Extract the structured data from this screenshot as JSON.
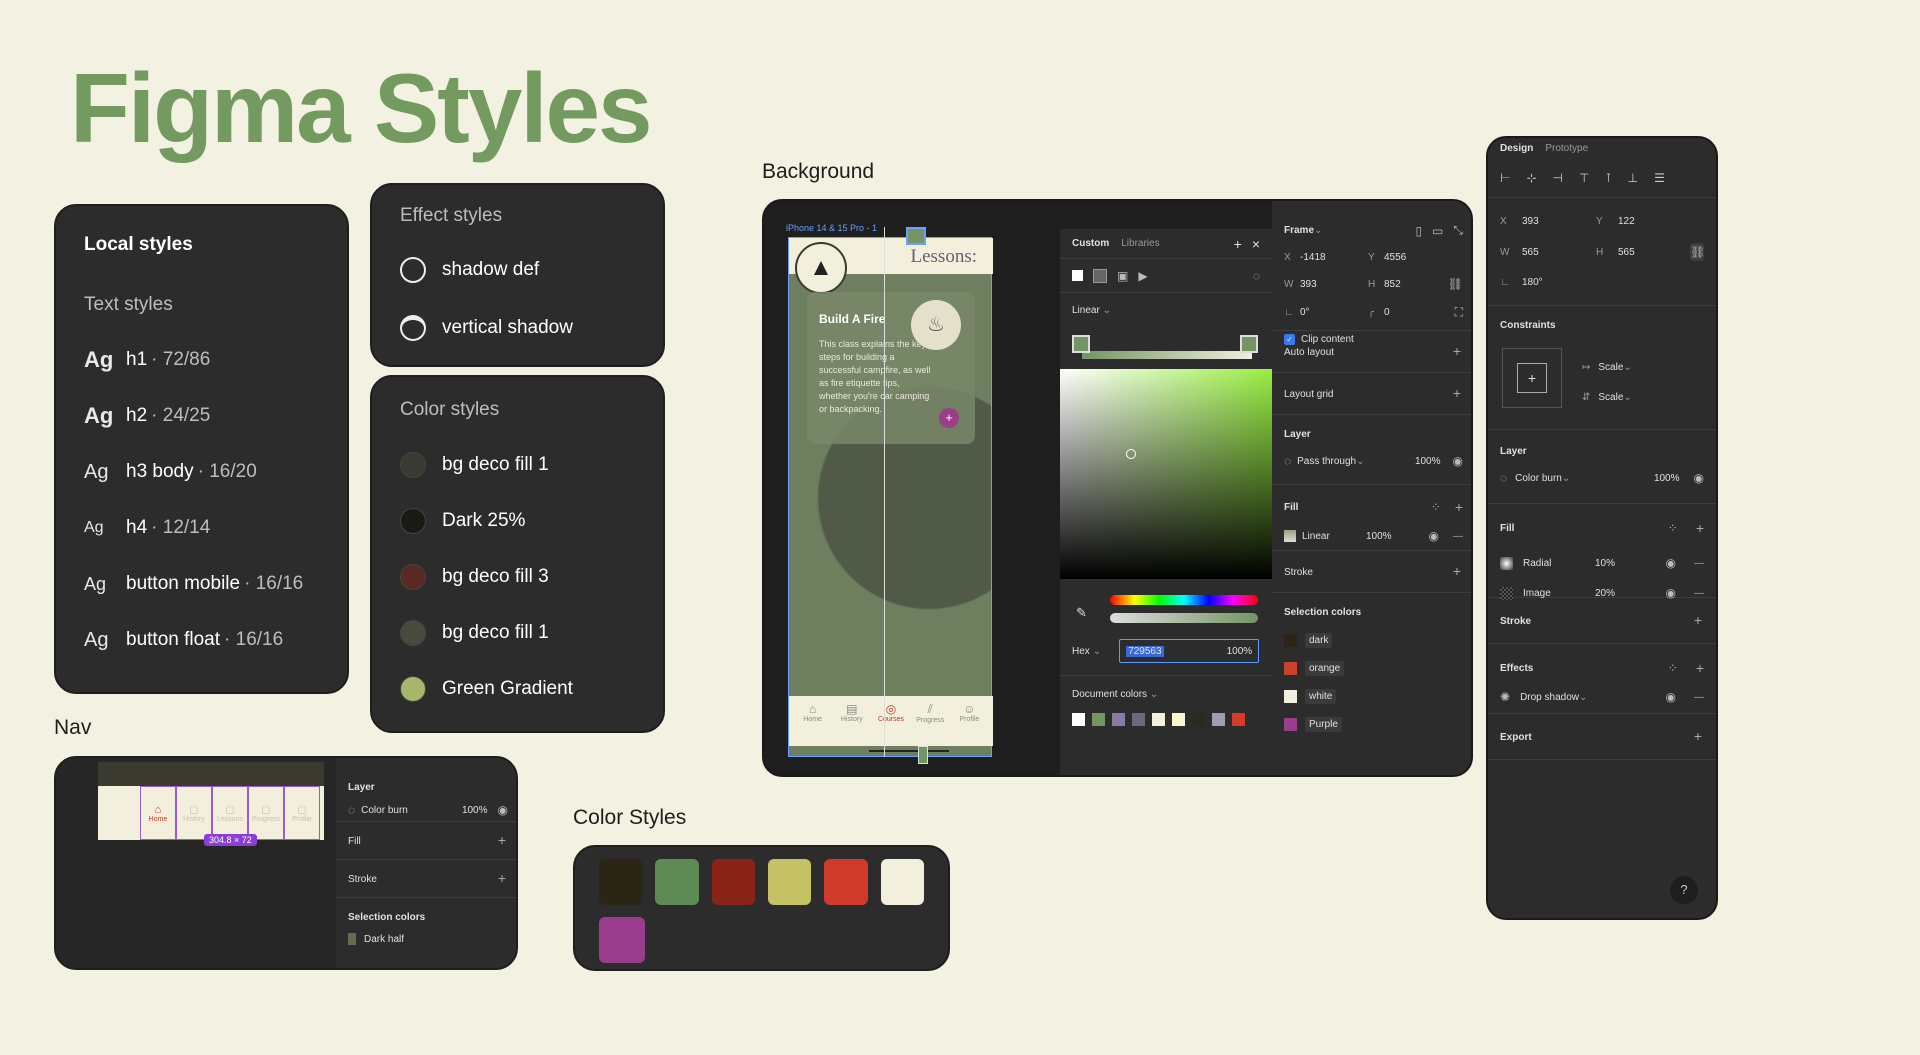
{
  "title": "Figma Styles",
  "captions": {
    "nav": "Nav",
    "background": "Background",
    "color_styles": "Color Styles"
  },
  "local_styles": {
    "heading": "Local styles",
    "text_styles_label": "Text styles",
    "items": [
      {
        "ag": "Ag",
        "name": "h1",
        "meta": "· 72/86"
      },
      {
        "ag": "Ag",
        "name": "h2",
        "meta": "· 24/25"
      },
      {
        "ag": "Ag",
        "name": "h3 body",
        "meta": "· 16/20"
      },
      {
        "ag": "Ag",
        "name": "h4",
        "meta": "· 12/14"
      },
      {
        "ag": "Ag",
        "name": "button mobile",
        "meta": "· 16/16"
      },
      {
        "ag": "Ag",
        "name": "button float",
        "meta": "· 16/16"
      }
    ]
  },
  "effect_styles": {
    "heading": "Effect styles",
    "items": [
      "shadow def",
      "vertical shadow"
    ]
  },
  "color_styles": {
    "heading": "Color styles",
    "items": [
      {
        "name": "bg deco fill 1",
        "color": "#3a3a32"
      },
      {
        "name": "Dark 25%",
        "color": "#1a1a14"
      },
      {
        "name": "bg deco fill 3",
        "color": "#5a2a22"
      },
      {
        "name": "bg deco fill 1",
        "color": "#4a4a3c"
      },
      {
        "name": "Green Gradient",
        "color": "#a7b86a"
      }
    ]
  },
  "nav_panel": {
    "tabs": [
      "Home",
      "History",
      "Lessons",
      "Progress",
      "Profile"
    ],
    "size_badge": "304.8 × 72",
    "layer_label": "Layer",
    "blend": "Color burn",
    "opacity": "100%",
    "fill": "Fill",
    "stroke": "Stroke",
    "selection_colors": "Selection colors",
    "sel_item": "Dark half"
  },
  "phone": {
    "frame_label": "iPhone 14 & 15 Pro - 1",
    "lessons": "Lessons:",
    "card_title": "Build A Fire",
    "card_text": "This class explains the key steps for building a successful campfire, as well as fire etiquette tips, whether you're car camping or backpacking.",
    "nav": [
      "Home",
      "History",
      "Courses",
      "Progress",
      "Profile"
    ]
  },
  "picker": {
    "tabs": [
      "Custom",
      "Libraries"
    ],
    "mode": "Linear",
    "hex_label": "Hex",
    "hex_value": "729563",
    "hex_opacity": "100%",
    "doc_colors": "Document colors",
    "doc_swatches": [
      "#ffffff",
      "#729563",
      "#8a7aa0",
      "#6a6a7a",
      "#f2efdc",
      "#fff4d0",
      "#2a2a24",
      "#9aa0b0",
      "#d83a2a"
    ]
  },
  "frame_panel": {
    "frame_label": "Frame",
    "x_label": "X",
    "x": "-1418",
    "y_label": "Y",
    "y": "4556",
    "w_label": "W",
    "w": "393",
    "h_label": "H",
    "h": "852",
    "rot": "0°",
    "radius": "0",
    "clip": "Clip content",
    "auto_layout": "Auto layout",
    "layout_grid": "Layout grid",
    "layer": "Layer",
    "blend": "Pass through",
    "opacity": "100%",
    "fill": "Fill",
    "fill_type": "Linear",
    "fill_opacity": "100%",
    "stroke": "Stroke",
    "selection_colors": "Selection colors",
    "sel": [
      {
        "name": "dark",
        "color": "#2a2514"
      },
      {
        "name": "orange",
        "color": "#c8432a"
      },
      {
        "name": "white",
        "color": "#f2efdc"
      },
      {
        "name": "Purple",
        "color": "#9a3d8c"
      }
    ]
  },
  "design_panel": {
    "tabs": [
      "Design",
      "Prototype"
    ],
    "x_label": "X",
    "x": "393",
    "y_label": "Y",
    "y": "122",
    "w_label": "W",
    "w": "565",
    "h_label": "H",
    "h": "565",
    "rot": "180°",
    "constraints": "Constraints",
    "c1": "Scale",
    "c2": "Scale",
    "layer": "Layer",
    "blend": "Color burn",
    "opacity": "100%",
    "fill": "Fill",
    "fills": [
      {
        "type": "Radial",
        "pct": "10%"
      },
      {
        "type": "Image",
        "pct": "20%"
      }
    ],
    "stroke": "Stroke",
    "effects": "Effects",
    "effect": "Drop shadow",
    "export": "Export",
    "help": "?"
  },
  "swatches": {
    "row1": [
      "#2a2514",
      "#5d8a55",
      "#8a2418",
      "#c5c265",
      "#d03a2a",
      "#f2efdc"
    ],
    "row2": [
      "#9a3d8c",
      "#7a5a7a",
      "#f2efdc",
      "#2a2514",
      "#e03030"
    ]
  }
}
